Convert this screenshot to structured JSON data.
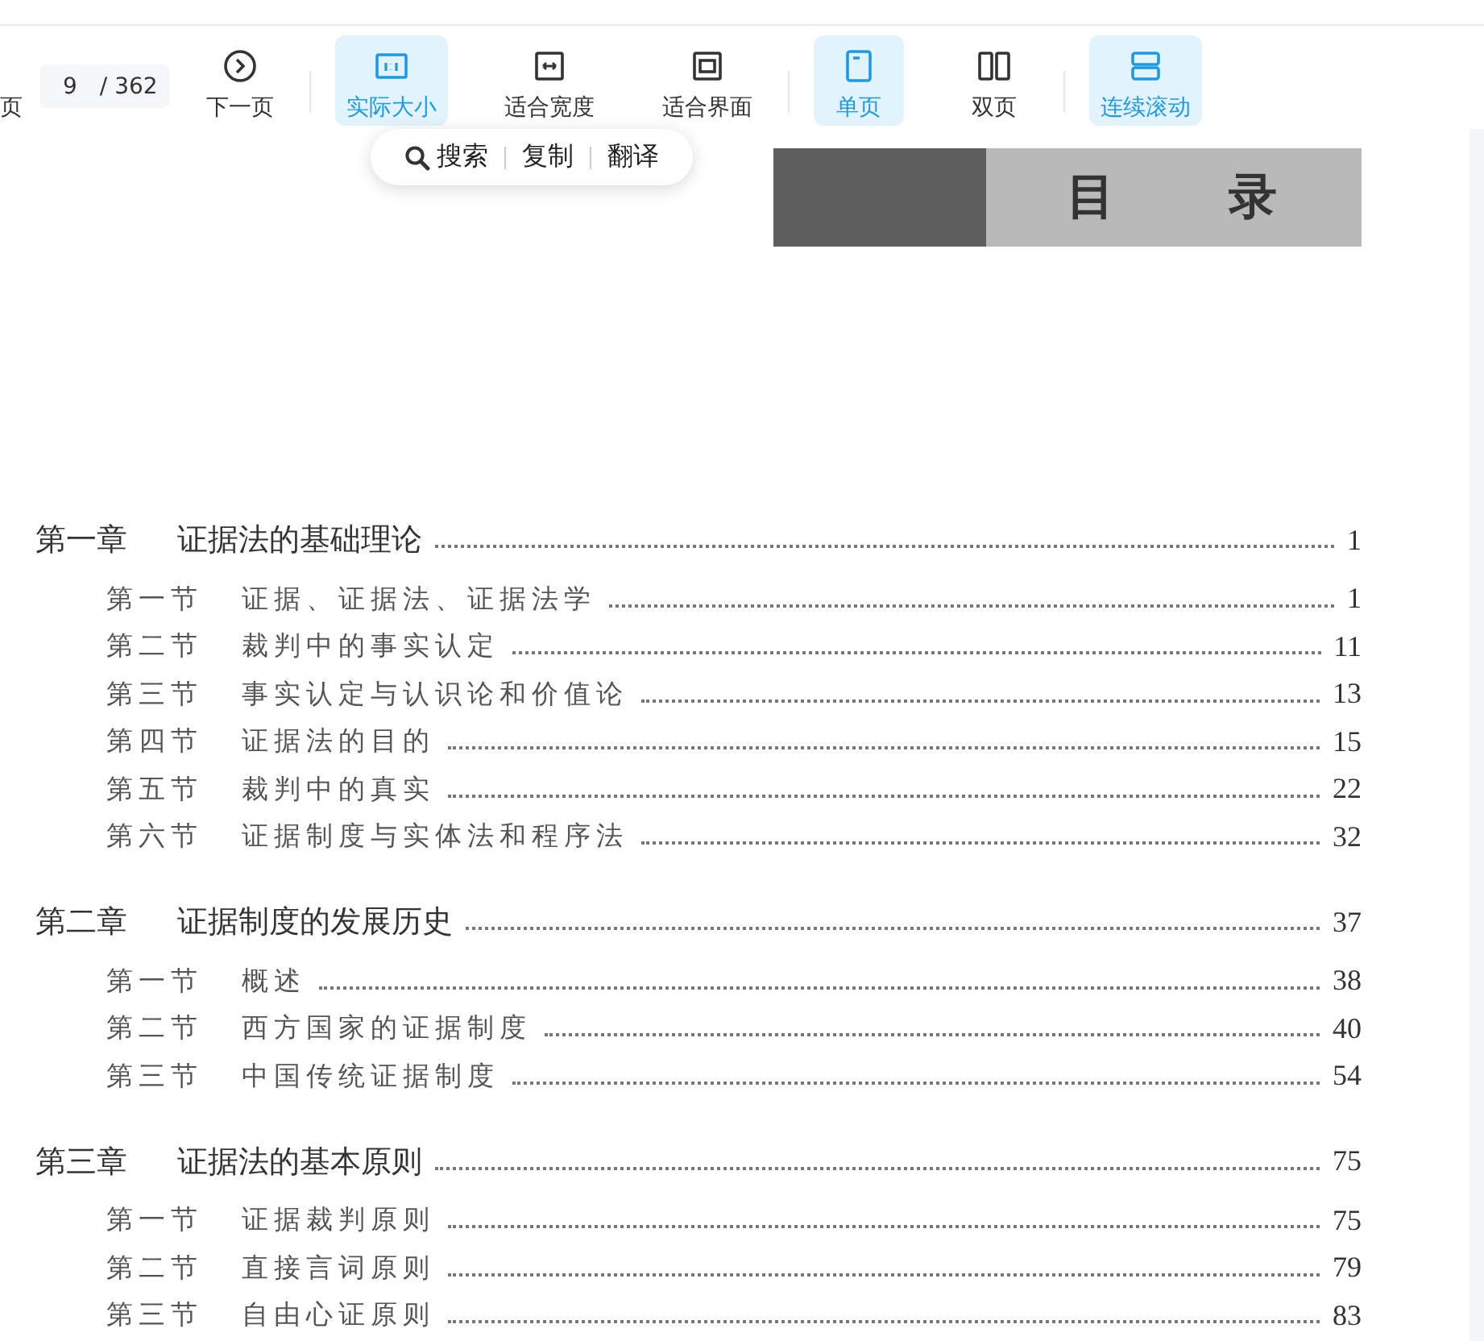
{
  "pager": {
    "prev_label": "页",
    "page": "9",
    "total": "/ 362",
    "next_label": "下一页"
  },
  "zoom_modes": [
    {
      "label": "实际大小",
      "selected": true
    },
    {
      "label": "适合宽度",
      "selected": false
    },
    {
      "label": "适合界面",
      "selected": false
    }
  ],
  "page_modes": [
    {
      "label": "单页",
      "selected": true
    },
    {
      "label": "双页",
      "selected": false
    }
  ],
  "scroll_modes": [
    {
      "label": "连续滚动",
      "selected": true
    }
  ],
  "selection_popup": {
    "actions": [
      "搜索",
      "复制",
      "翻译"
    ]
  },
  "document": {
    "heading": "目 录",
    "toc": [
      {
        "label": "第一章",
        "title": "证据法的基础理论",
        "page": "1",
        "children": [
          {
            "label": "第一节",
            "title": "证据、证据法、证据法学",
            "page": "1"
          },
          {
            "label": "第二节",
            "title": "裁判中的事实认定",
            "page": "11"
          },
          {
            "label": "第三节",
            "title": "事实认定与认识论和价值论",
            "page": "13"
          },
          {
            "label": "第四节",
            "title": "证据法的目的",
            "page": "15"
          },
          {
            "label": "第五节",
            "title": "裁判中的真实",
            "page": "22"
          },
          {
            "label": "第六节",
            "title": "证据制度与实体法和程序法",
            "page": "32"
          }
        ]
      },
      {
        "label": "第二章",
        "title": "证据制度的发展历史",
        "page": "37",
        "children": [
          {
            "label": "第一节",
            "title": "概述",
            "page": "38"
          },
          {
            "label": "第二节",
            "title": "西方国家的证据制度",
            "page": "40"
          },
          {
            "label": "第三节",
            "title": "中国传统证据制度",
            "page": "54"
          }
        ]
      },
      {
        "label": "第三章",
        "title": "证据法的基本原则",
        "page": "75",
        "children": [
          {
            "label": "第一节",
            "title": "证据裁判原则",
            "page": "75"
          },
          {
            "label": "第二节",
            "title": "直接言词原则",
            "page": "79"
          },
          {
            "label": "第三节",
            "title": "自由心证原则",
            "page": "83"
          }
        ]
      }
    ]
  }
}
